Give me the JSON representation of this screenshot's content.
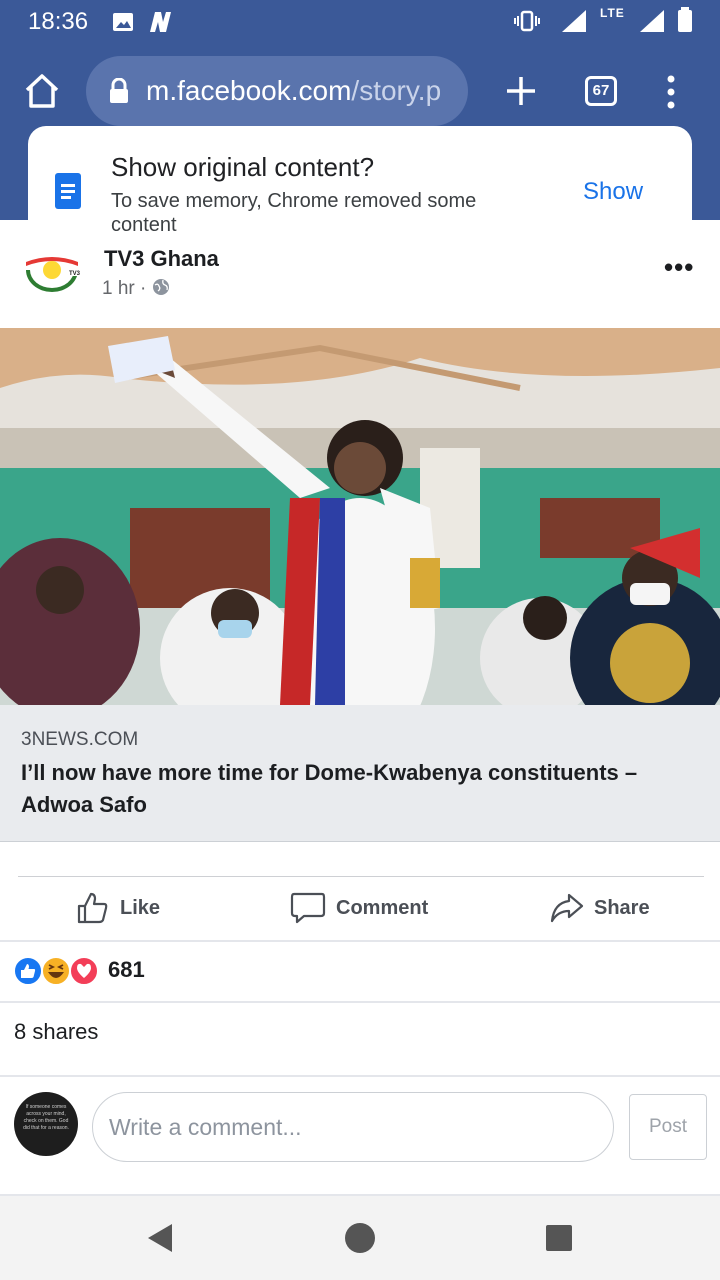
{
  "status_bar": {
    "time": "18:36",
    "network": "LTE",
    "icons": [
      "image-icon",
      "n-app-icon",
      "vibrate-icon",
      "signal-icon",
      "battery-icon"
    ]
  },
  "browser": {
    "url_host": "m.facebook.com",
    "url_path": "/story.p",
    "tab_count": "67",
    "icons": [
      "home-icon",
      "lock-icon",
      "new-tab-icon",
      "menu-icon"
    ]
  },
  "prompt": {
    "title": "Show original content?",
    "body": "To save memory, Chrome removed some content",
    "action": "Show"
  },
  "post": {
    "page_name": "TV3 Ghana",
    "time": "1 hr",
    "separator": "·",
    "more": "•••"
  },
  "link": {
    "domain": "3NEWS.COM",
    "headline": "I’ll now have more time for Dome-Kwabenya constituents – Adwoa Safo"
  },
  "actions": {
    "like": "Like",
    "comment": "Comment",
    "share": "Share"
  },
  "reactions": {
    "count": "681",
    "types": [
      "like",
      "haha",
      "love"
    ]
  },
  "shares": "8 shares",
  "composer": {
    "placeholder": "Write a comment...",
    "post_label": "Post"
  },
  "colors": {
    "facebook_blue": "#3b5998",
    "link_blue": "#1a73e8",
    "preview_bg": "#e9ebee"
  }
}
